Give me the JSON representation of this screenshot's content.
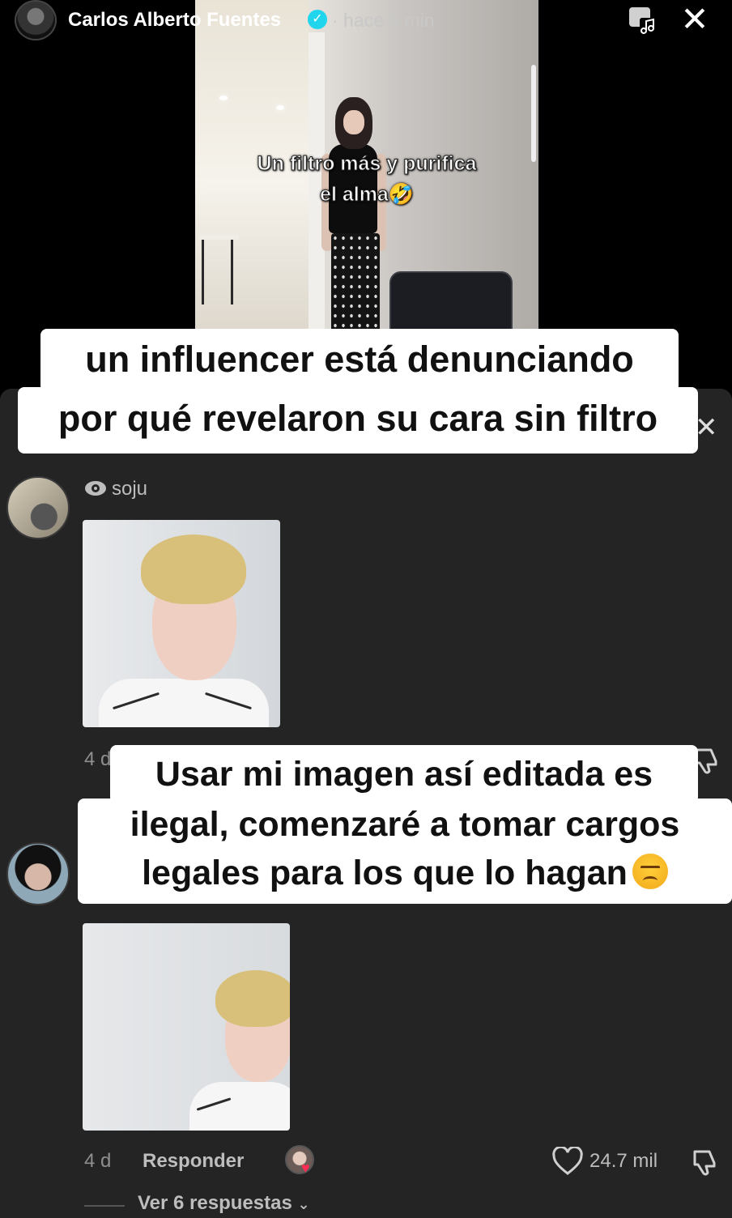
{
  "header": {
    "username": "Carlos Alberto Fuentes",
    "verified_icon": "verified-check-icon",
    "time": "· hace 6 min",
    "music_icon": "music-playlist-icon",
    "close_icon": "close-icon"
  },
  "video": {
    "caption_line1": "Un filtro más y purifica",
    "caption_line2": "el alma🤣"
  },
  "overlay_captions": {
    "top_line1": "un influencer está denunciando",
    "top_line2": "por qué revelaron su cara sin filtro",
    "middle_line1": "Usar mi imagen así editada es",
    "middle_line2": "ilegal, comenzaré a tomar cargos",
    "middle_line3": "legales para los que lo hagan"
  },
  "comments": [
    {
      "username": "soju",
      "time": "4 d"
    },
    {
      "time": "4 d",
      "reply_label": "Responder",
      "likes": "24.7 mil",
      "view_replies": "Ver 6 respuestas"
    }
  ],
  "colors": {
    "sheet_background": "#242424",
    "verified": "#20d5ec",
    "reply_heart": "#ff2d55"
  }
}
